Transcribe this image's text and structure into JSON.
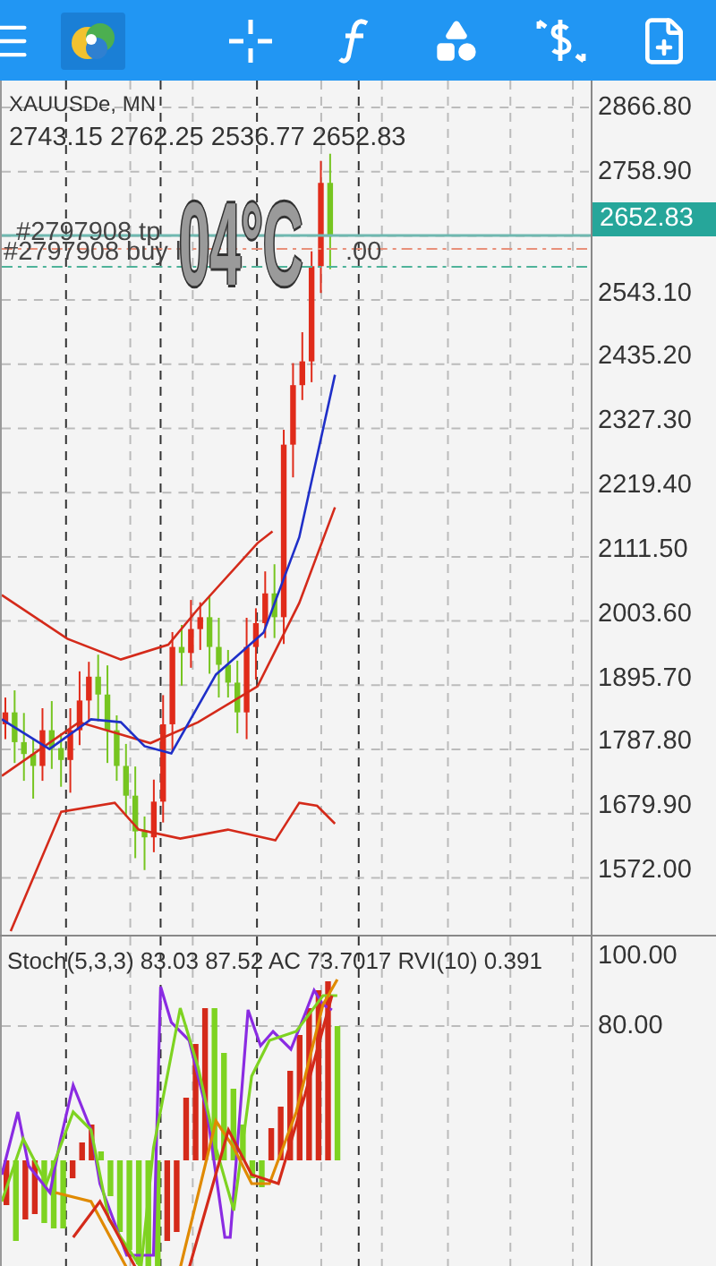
{
  "chart": {
    "symbol": "XAUUSDe, MN",
    "ohlc": "2743.15 2762.25 2536.77 2652.83",
    "price_axis": [
      "2866.80",
      "2758.90",
      "2543.10",
      "2435.20",
      "2327.30",
      "2219.40",
      "2111.50",
      "2003.60",
      "1895.70",
      "1787.80",
      "1679.90",
      "1572.00"
    ],
    "current_price": "2652.83",
    "orders": [
      {
        "label": "#2797908 tp"
      },
      {
        "label": "#2797908 buy l",
        "tail": ".00"
      }
    ],
    "overlay_text": "04°C"
  },
  "subwindow": {
    "legend": "Stoch(5,3,3) 83.03 87.52 AC 73.7017 RVI(10) 0.391",
    "axis": [
      "100.00",
      "80.00"
    ]
  }
}
